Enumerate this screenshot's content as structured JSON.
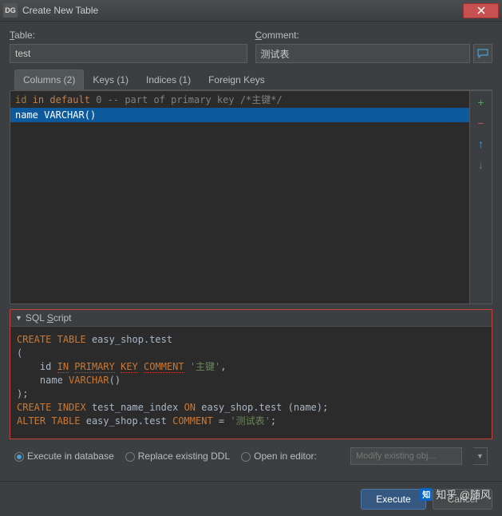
{
  "titlebar": {
    "icon": "DG",
    "title": "Create New Table"
  },
  "fields": {
    "table_label": "Table:",
    "table_label_u": "T",
    "table_value": "test",
    "comment_label": "Comment:",
    "comment_label_u": "C",
    "comment_value": "测试表"
  },
  "tabs": [
    {
      "label": "Columns (2)",
      "active": true
    },
    {
      "label": "Keys (1)",
      "active": false
    },
    {
      "label": "Indices (1)",
      "active": false
    },
    {
      "label": "Foreign Keys",
      "active": false
    }
  ],
  "columns": [
    {
      "raw": "id in default 0 -- part of primary key /*主键*/",
      "selected": false
    },
    {
      "raw": "name VARCHAR()",
      "selected": true
    }
  ],
  "gutter": {
    "add": "+",
    "remove": "−",
    "up": "↑",
    "down": "↓"
  },
  "script": {
    "header": "SQL Script",
    "header_u": "S",
    "lines": [
      "CREATE TABLE easy_shop.test",
      "(",
      "    id IN PRIMARY KEY COMMENT '主键',",
      "    name VARCHAR()",
      ");",
      "CREATE INDEX test_name_index ON easy_shop.test (name);",
      "ALTER TABLE easy_shop.test COMMENT = '测试表';"
    ]
  },
  "options": {
    "opt1": "Execute in database",
    "opt2": "Replace existing DDL",
    "opt3": "Open in editor:",
    "combo": "Modify existing obj..."
  },
  "footer": {
    "execute": "Execute",
    "cancel": "Cancel"
  },
  "watermark": "知乎 @随风"
}
